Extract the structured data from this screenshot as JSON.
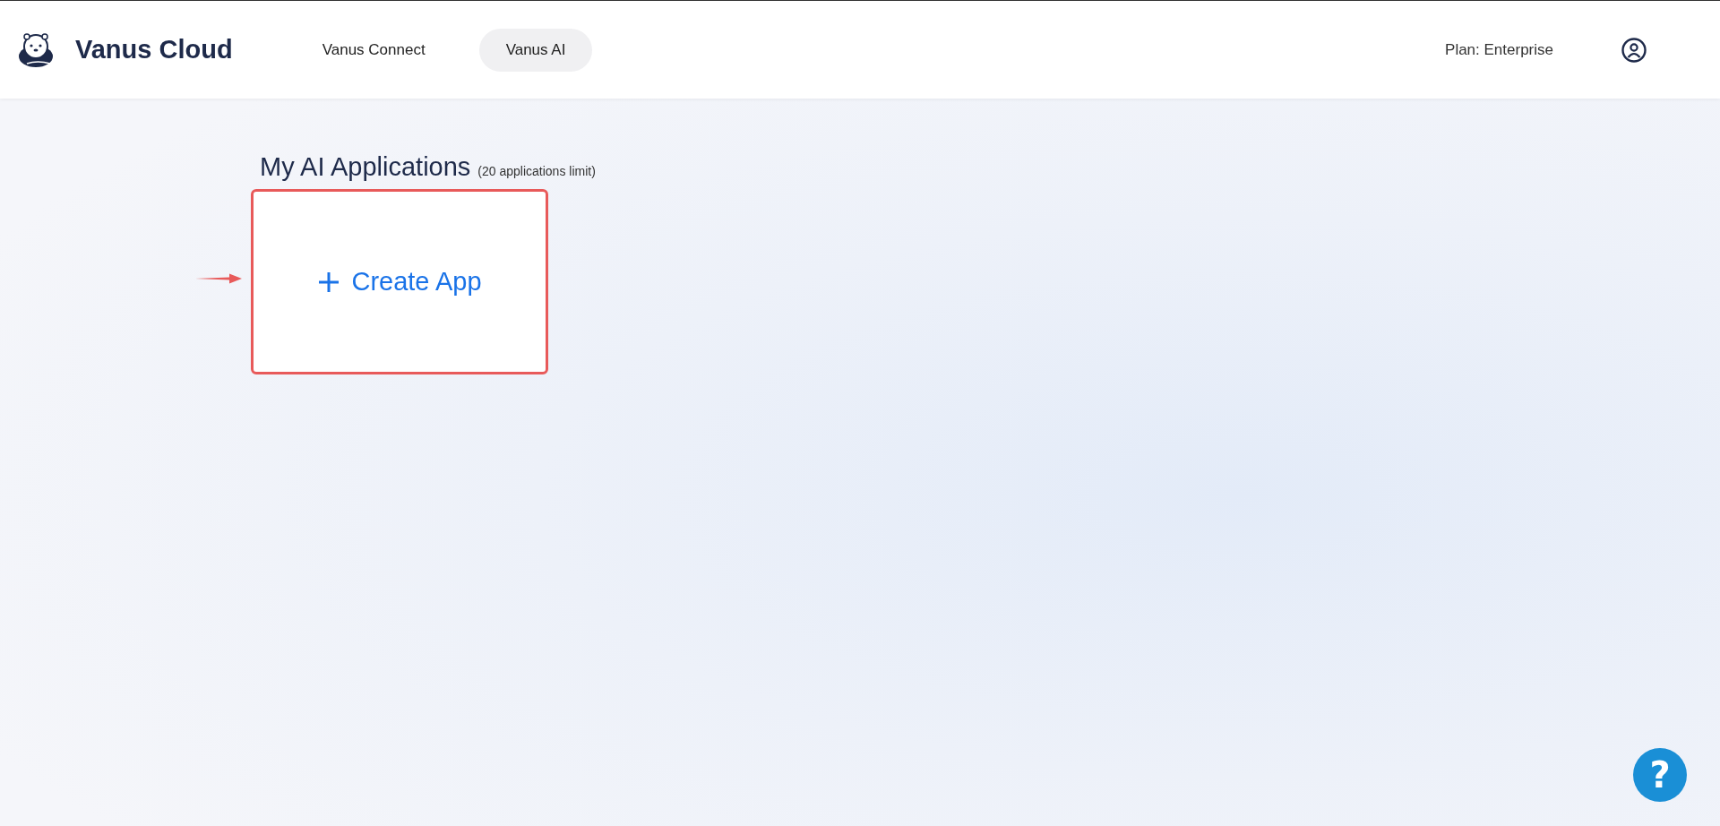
{
  "header": {
    "brand": "Vanus Cloud",
    "tabs": [
      {
        "label": "Vanus Connect",
        "selected": false
      },
      {
        "label": "Vanus AI",
        "selected": true
      }
    ],
    "plan": "Plan: Enterprise"
  },
  "main": {
    "title": "My AI Applications",
    "subtitle": "(20 applications limit)",
    "create_card": {
      "label": "Create App",
      "highlighted": true
    }
  },
  "help_button": {
    "label": "?"
  }
}
